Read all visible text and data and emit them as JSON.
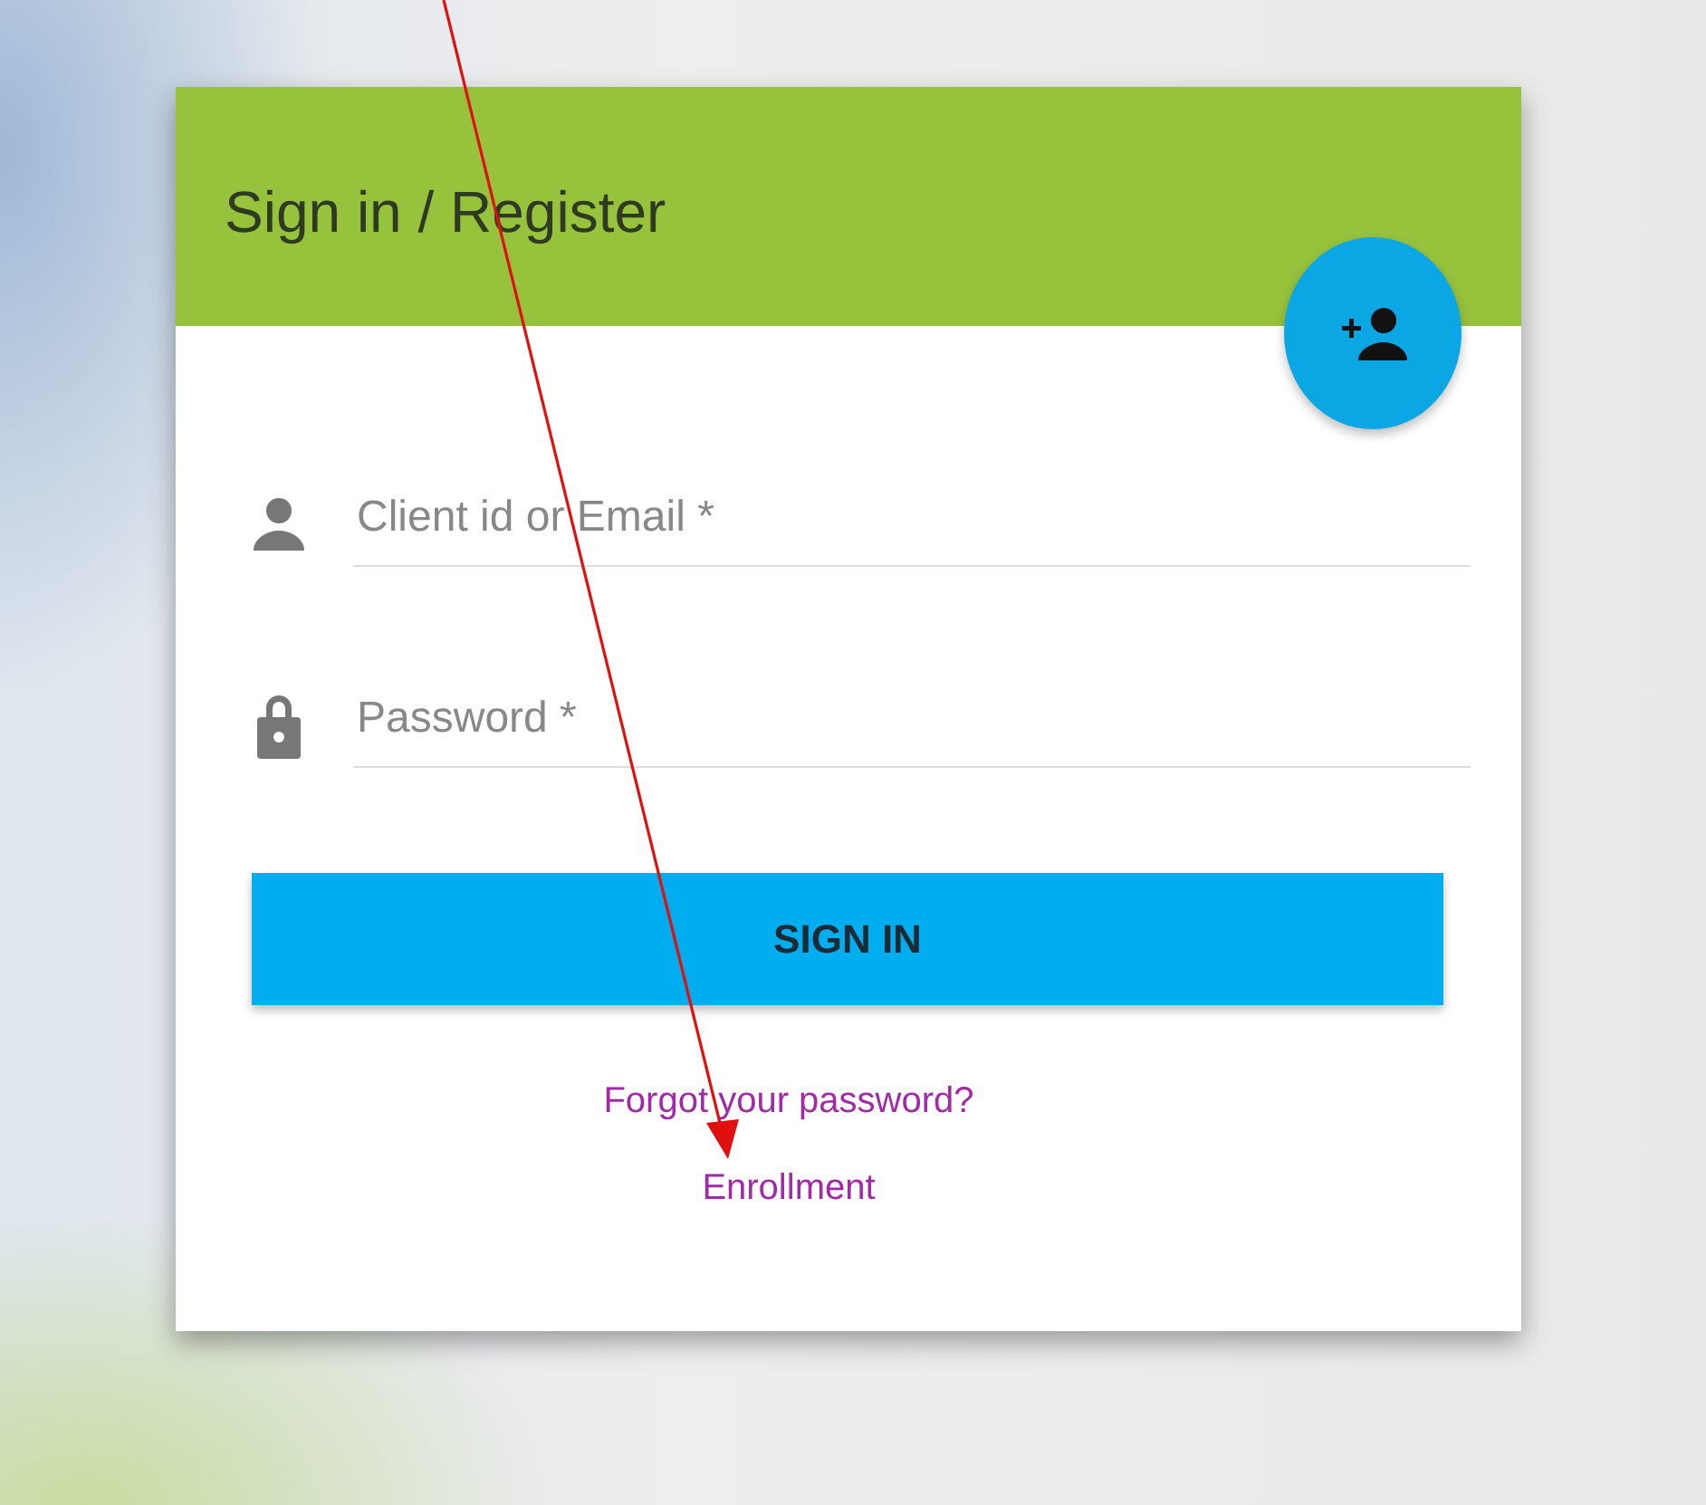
{
  "card": {
    "title": "Sign in / Register"
  },
  "fields": [
    {
      "kind": "user",
      "placeholder": "Client id or Email *"
    },
    {
      "kind": "lock",
      "placeholder": "Password *"
    }
  ],
  "button": {
    "label": "SIGN IN"
  },
  "links": [
    {
      "label": "Forgot your password?"
    },
    {
      "label": "Enrollment"
    }
  ],
  "annotation": {
    "kind": "arrow"
  }
}
